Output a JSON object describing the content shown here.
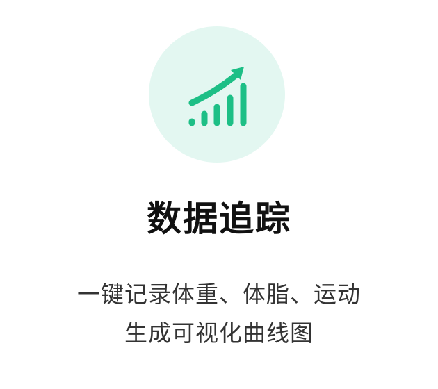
{
  "feature": {
    "icon": "trend-up-chart-icon",
    "title": "数据追踪",
    "description_lines": [
      "一键记录体重、体脂、运动",
      "生成可视化曲线图"
    ]
  },
  "colors": {
    "accent": "#1dbf86",
    "icon_background": "#e3f7f1",
    "title": "#111111",
    "description": "#333333"
  }
}
